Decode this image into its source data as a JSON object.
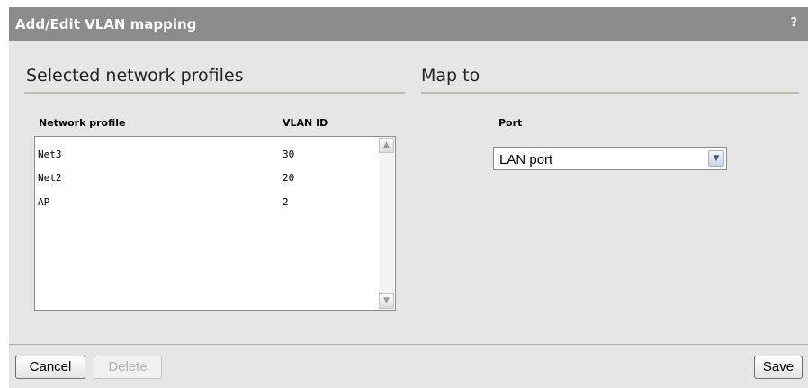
{
  "dialog": {
    "title": "Add/Edit VLAN mapping",
    "help_label": "?"
  },
  "left_panel": {
    "heading": "Selected network profiles",
    "columns": [
      "Network profile",
      "VLAN ID"
    ],
    "rows": [
      {
        "profile": "Net3",
        "vlan": "30"
      },
      {
        "profile": "Net2",
        "vlan": "20"
      },
      {
        "profile": "AP",
        "vlan": "2"
      }
    ],
    "scroll_up_icon": "triangle-up",
    "scroll_down_icon": "triangle-down"
  },
  "right_panel": {
    "heading": "Map to",
    "port_label": "Port",
    "port_value": "LAN port",
    "dropdown_icon": "chevron-down"
  },
  "footer": {
    "cancel_label": "Cancel",
    "delete_label": "Delete",
    "save_label": "Save"
  }
}
